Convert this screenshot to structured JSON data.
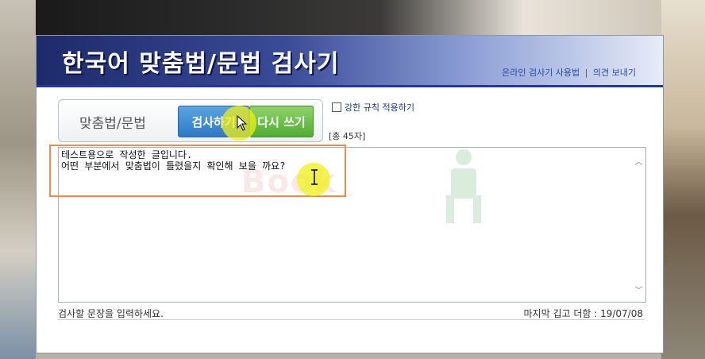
{
  "banner": {
    "title": "한국어 맞춤법/문법 검사기",
    "link_help": "온라인 검사기 사용법",
    "link_separator": "|",
    "link_feedback": "의견 보내기"
  },
  "controls": {
    "label": "맞춤법/문법",
    "check_button": "검사하기",
    "reset_button": "다시 쓰기",
    "strict_option_label": "강한 규칙 적용하기",
    "char_count": "[총 45자]"
  },
  "editor": {
    "text": "테스트용으로 작성한 글입니다.\n어떤 부분에서 맞춤법이 틀렸을지 확인해 보을 까요?",
    "scroll_up": "︿",
    "scroll_down": "﹀"
  },
  "watermark": {
    "text": "Book"
  },
  "footer": {
    "hint": "검사할 문장을 입력하세요.",
    "last_updated": "마지막 깁고 더함 : 19/07/08"
  },
  "colors": {
    "banner_dark": "#1d2a6a",
    "check_button": "#2f78c6",
    "reset_button": "#4fae31",
    "link": "#2d4aa8",
    "highlight_box": "#f08a4b",
    "highlight_dot": "#f0f014"
  }
}
